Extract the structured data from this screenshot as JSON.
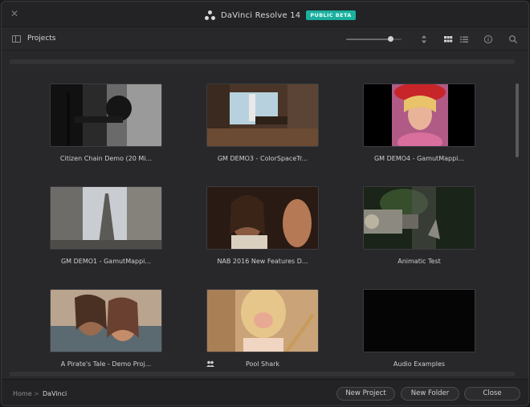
{
  "app": {
    "title": "DaVinci Resolve 14",
    "badge": "PUBLIC BETA",
    "close_glyph": "✕"
  },
  "toolbar": {
    "panel_icon": "panel-toggle-icon",
    "label": "Projects",
    "thumb_size_value": 0.8,
    "icons": {
      "sort": "sort-icon",
      "grid_view": "grid-view-icon",
      "list_view": "list-view-icon",
      "info": "info-icon",
      "search": "search-icon"
    }
  },
  "projects": [
    {
      "name": "Citizen Chain Demo (20 Mi...",
      "shared": false
    },
    {
      "name": "GM DEMO3 - ColorSpaceTr...",
      "shared": false
    },
    {
      "name": "GM DEMO4 - GamutMappi...",
      "shared": false
    },
    {
      "name": "GM DEMO1 - GamutMappi...",
      "shared": false
    },
    {
      "name": "NAB 2016 New Features D...",
      "shared": false
    },
    {
      "name": "Animatic Test",
      "shared": false
    },
    {
      "name": "A Pirate's Tale - Demo Proj...",
      "shared": false
    },
    {
      "name": "Pool Shark",
      "shared": true
    },
    {
      "name": "Audio Examples",
      "shared": false
    }
  ],
  "footer": {
    "breadcrumb": {
      "home": "Home",
      "separator": ">",
      "current": "DaVinci"
    },
    "buttons": {
      "new_project": "New Project",
      "new_folder": "New Folder",
      "close": "Close"
    }
  },
  "colors": {
    "accent": "#1aaf9e",
    "window_bg": "#28282b",
    "titlebar_bg": "#232326"
  }
}
